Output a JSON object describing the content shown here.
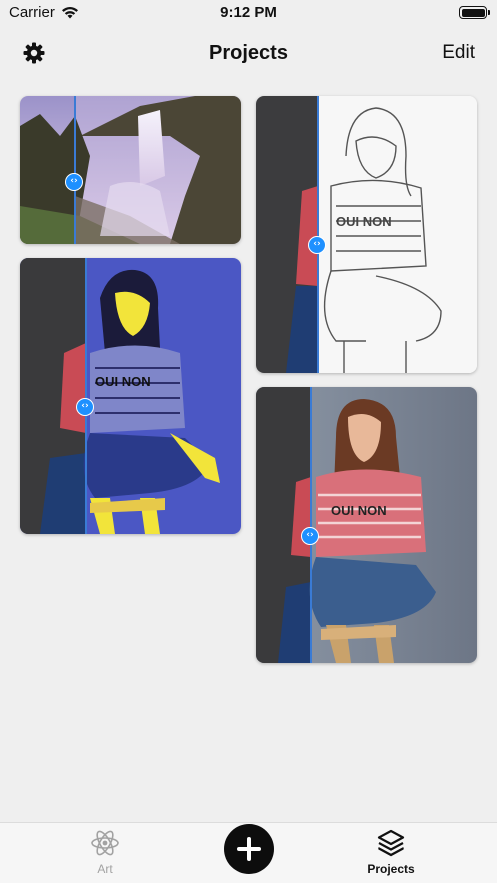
{
  "status_bar": {
    "carrier": "Carrier",
    "time": "9:12 PM"
  },
  "nav": {
    "title": "Projects",
    "edit_label": "Edit",
    "settings_icon": "gear-icon"
  },
  "projects": [
    {
      "name": "waterfall-project",
      "subject": "waterfall landscape",
      "style": "dreamy purple filter"
    },
    {
      "name": "pencil-sketch-project",
      "subject": "woman seated",
      "style": "pencil sketch"
    },
    {
      "name": "blue-paint-project",
      "subject": "woman seated",
      "style": "blue and yellow painting"
    },
    {
      "name": "portrait-project",
      "subject": "woman seated",
      "style": "soft portrait"
    }
  ],
  "compare_handle_icon": "chevron-left-right-icon",
  "tab_bar": {
    "art_label": "Art",
    "projects_label": "Projects",
    "art_icon": "atom-icon",
    "projects_icon": "layers-icon",
    "add_icon": "plus-icon",
    "active_tab": "Projects"
  },
  "colors": {
    "background": "#efefef",
    "accent": "#1e90ff",
    "tab_active": "#111111",
    "tab_inactive": "#a2a2a2"
  }
}
